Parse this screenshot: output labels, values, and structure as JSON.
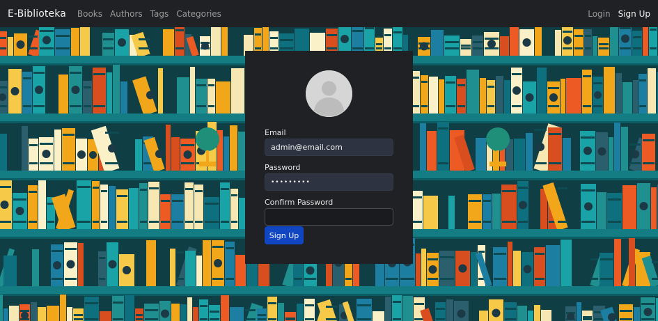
{
  "navbar": {
    "brand": "E-Biblioteka",
    "links": [
      "Books",
      "Authors",
      "Tags",
      "Categories"
    ],
    "login": "Login",
    "signup": "Sign Up"
  },
  "form": {
    "email_label": "Email",
    "email_value": "admin@email.com",
    "password_label": "Password",
    "password_value": "•••••••••",
    "confirm_label": "Confirm Password",
    "confirm_value": "",
    "submit_label": "Sign Up"
  },
  "colors": {
    "navbar_bg": "#202124",
    "panel_bg": "#202124",
    "button_bg": "#1046c2",
    "shelf": "#127a80",
    "wall": "#0f3e45"
  },
  "icons": {
    "avatar": "user-avatar-icon",
    "background": "bookshelf-illustration"
  }
}
